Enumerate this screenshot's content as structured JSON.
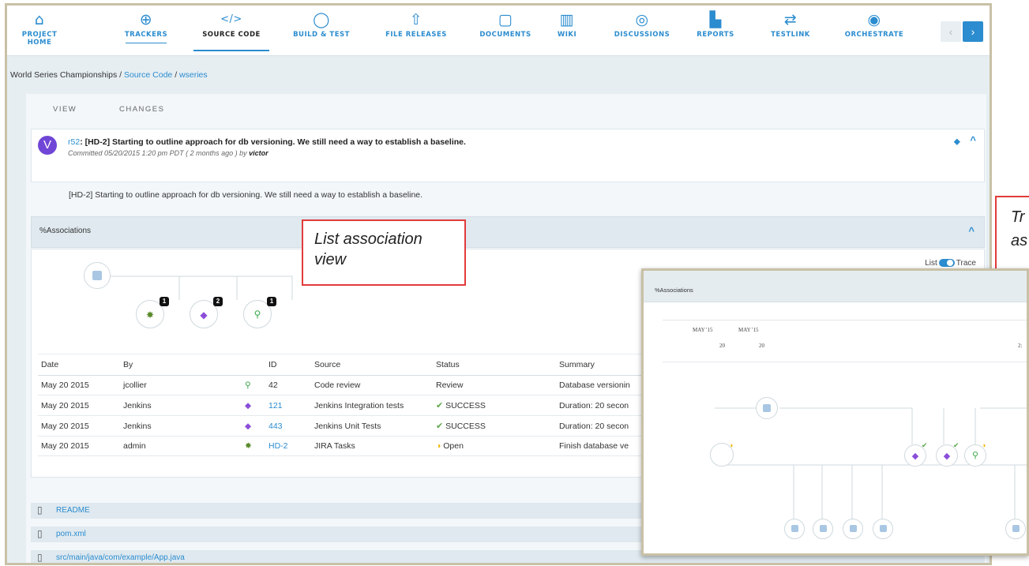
{
  "nav": {
    "items": [
      {
        "label": "PROJECT HOME",
        "icon": "home-icon"
      },
      {
        "label": "TRACKERS",
        "icon": "tracker-icon"
      },
      {
        "label": "SOURCE CODE",
        "icon": "code-icon"
      },
      {
        "label": "BUILD & TEST",
        "icon": "build-icon"
      },
      {
        "label": "FILE RELEASES",
        "icon": "upload-icon"
      },
      {
        "label": "DOCUMENTS",
        "icon": "document-icon"
      },
      {
        "label": "WIKI",
        "icon": "book-icon"
      },
      {
        "label": "DISCUSSIONS",
        "icon": "discussion-icon"
      },
      {
        "label": "REPORTS",
        "icon": "chart-icon"
      },
      {
        "label": "TESTLINK",
        "icon": "shuffle-icon"
      },
      {
        "label": "ORCHESTRATE",
        "icon": "orchestrate-icon"
      }
    ],
    "prev_glyph": "‹",
    "next_glyph": "›"
  },
  "breadcrumb": {
    "root": "World Series Championships",
    "sep": "/",
    "section": "Source Code",
    "repo": "wseries"
  },
  "tabs": {
    "view": "VIEW",
    "changes": "CHANGES"
  },
  "commit": {
    "avatar_letter": "V",
    "rev": "r52",
    "title": ": [HD-2] Starting to outline approach for db versioning. We still need a way to establish a baseline.",
    "meta_prefix": "Committed 05/20/2015 1:20 pm PDT ( 2 months ago ) by ",
    "author": "victor",
    "body": "[HD-2] Starting to outline approach for db versioning. We still need a way to establish a baseline."
  },
  "associations": {
    "title": "Associations",
    "list_label": "List",
    "trace_label": "Trace",
    "graph_badges": [
      "1",
      "2",
      "1"
    ],
    "columns": [
      "Date",
      "By",
      "",
      "ID",
      "Source",
      "Status",
      "Summary"
    ],
    "rows": [
      {
        "date": "May 20 2015",
        "by": "jcollier",
        "id": "42",
        "source": "Code review",
        "status": "Review",
        "summary": "Database versionin",
        "icon": "review-icon",
        "status_icon": ""
      },
      {
        "date": "May 20 2015",
        "by": "Jenkins",
        "id": "121",
        "source": "Jenkins Integration tests",
        "status": "SUCCESS",
        "summary": "Duration: 20 secon",
        "icon": "build-cube-icon",
        "status_icon": "check-icon"
      },
      {
        "date": "May 20 2015",
        "by": "Jenkins",
        "id": "443",
        "source": "Jenkins Unit Tests",
        "status": "SUCCESS",
        "summary": "Duration: 20 secon",
        "icon": "build-cube-icon",
        "status_icon": "check-icon"
      },
      {
        "date": "May 20 2015",
        "by": "admin",
        "id": "HD-2",
        "source": "JIRA Tasks",
        "status": "Open",
        "summary": "Finish database ve",
        "icon": "bug-icon",
        "status_icon": "half-circle-icon"
      }
    ]
  },
  "files": [
    "README",
    "pom.xml",
    "src/main/java/com/example/App.java"
  ],
  "callouts": {
    "list_view": "List association view",
    "trace_view_partial": "Tr",
    "trace_view_partial2": "as"
  },
  "trace": {
    "title": "Associations",
    "dates": [
      {
        "month": "MAY '15",
        "day": "20"
      },
      {
        "month": "MAY '15",
        "day": "20"
      },
      {
        "month": "",
        "day": "2:"
      }
    ]
  },
  "colors": {
    "accent": "#2b8ccf",
    "callout": "#e23b3b",
    "frame": "#c9c1a6",
    "avatar": "#7046d6"
  }
}
